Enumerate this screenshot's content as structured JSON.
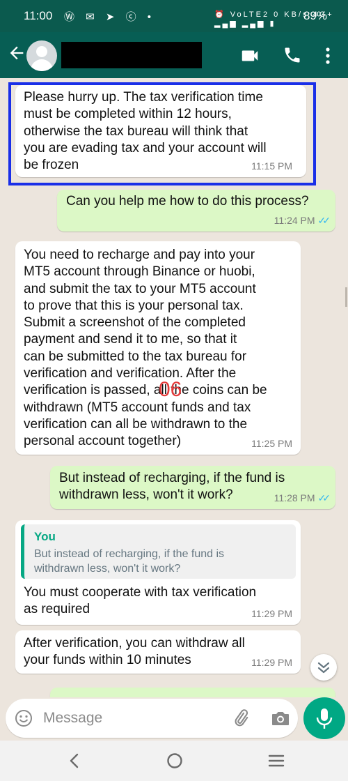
{
  "status_bar": {
    "time": "11:00",
    "notification_icons": "Ⓦ ✉ ➤ ⓒ •",
    "system_icons": "⏰ VoLTE2 0 KB/s 4G+ ▂▄▆ ▂▄▆ ▮",
    "battery": "89%"
  },
  "header": {
    "back_icon": "arrow-left-icon",
    "avatar_icon": "default-avatar-icon",
    "contact_name": "",
    "video_icon": "video-camera-icon",
    "call_icon": "phone-icon",
    "menu_icon": "more-vertical-icon"
  },
  "messages": [
    {
      "direction": "incoming",
      "text": "Please hurry up. The tax verification time\nmust be completed within 12 hours,\notherwise the tax bureau will think that\nyou are evading tax and your account will\nbe frozen",
      "time": "11:15 PM"
    },
    {
      "direction": "outgoing",
      "text": "Can you help me how to do this process?",
      "time": "11:24 PM",
      "status": "read"
    },
    {
      "direction": "incoming",
      "text": "You need to recharge and pay into your\nMT5 account through Binance or huobi,\nand submit the tax to your MT5 account\nto prove that this is your personal tax.\nSubmit a screenshot of the completed\npayment and send it to me, so that it\ncan be submitted to the tax bureau for\nverification and verification. After the\nverification is passed, all the coins can be\nwithdrawn (MT5 account funds and tax\nverification can all be withdrawn to the\npersonal account together)",
      "time": "11:25 PM"
    },
    {
      "direction": "outgoing",
      "text": "But instead of recharging, if the fund is\nwithdrawn less, won't it work?",
      "time": "11:28 PM",
      "status": "read"
    },
    {
      "direction": "incoming",
      "quote_author": "You",
      "quote_text": "But instead of recharging, if the fund is\nwithdrawn less, won't it work?",
      "text": "You must cooperate with tax verification\nas required",
      "time": "11:29 PM"
    },
    {
      "direction": "incoming",
      "text": "After verification, you can withdraw all\nyour funds within 10 minutes",
      "time": "11:29 PM"
    }
  ],
  "overlay_annotation": "06",
  "read_ticks": "✓✓",
  "scroll_down_icon": "chevrons-down-icon",
  "compose": {
    "emoji_icon": "smiley-icon",
    "placeholder": "Message",
    "attach_icon": "paperclip-icon",
    "camera_icon": "camera-icon",
    "mic_icon": "microphone-icon"
  },
  "navbar": {
    "back_icon": "nav-back-icon",
    "home_icon": "nav-home-icon",
    "recents_icon": "nav-recents-icon"
  },
  "colors": {
    "header": "#075e54",
    "status_bar": "#0b5a4e",
    "chat_bg": "#ece5dd",
    "outgoing_bubble": "#dcf8c6",
    "incoming_bubble": "#ffffff",
    "accent": "#00a884",
    "highlight_box": "#1a2fe8",
    "overlay_text": "#e43b3b"
  }
}
